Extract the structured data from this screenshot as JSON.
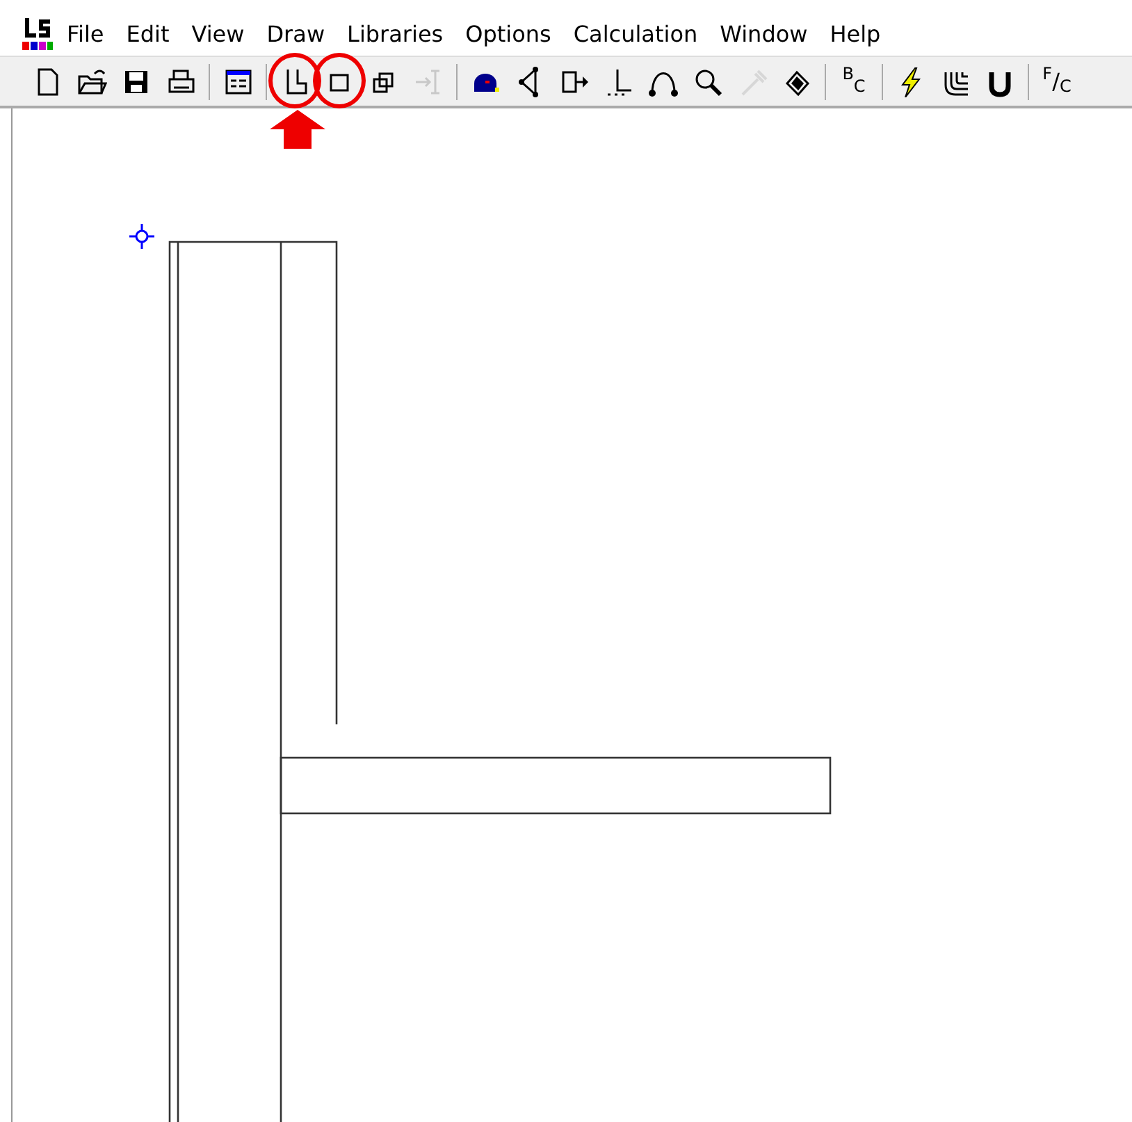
{
  "menu": [
    "File",
    "Edit",
    "View",
    "Draw",
    "Libraries",
    "Options",
    "Calculation",
    "Window",
    "Help"
  ],
  "toolbar": [
    {
      "kind": "icon",
      "disabled": false
    },
    {
      "kind": "icon",
      "disabled": false
    },
    {
      "kind": "icon",
      "disabled": false
    },
    {
      "kind": "icon",
      "disabled": false
    },
    {
      "kind": "separator"
    },
    {
      "kind": "icon",
      "disabled": false
    },
    {
      "kind": "separator"
    },
    {
      "kind": "icon",
      "disabled": false,
      "circled": true,
      "arrow_below": true
    },
    {
      "kind": "icon",
      "disabled": false,
      "circled": true,
      "arrow_below": false
    },
    {
      "kind": "icon",
      "disabled": false
    },
    {
      "kind": "icon",
      "disabled": true
    },
    {
      "kind": "separator"
    },
    {
      "kind": "icon",
      "disabled": false
    },
    {
      "kind": "icon",
      "disabled": false
    },
    {
      "kind": "icon",
      "disabled": false
    },
    {
      "kind": "icon",
      "disabled": false
    },
    {
      "kind": "icon",
      "disabled": false
    },
    {
      "kind": "icon",
      "disabled": false
    },
    {
      "kind": "icon",
      "disabled": true
    },
    {
      "kind": "icon",
      "disabled": false
    },
    {
      "kind": "separator"
    },
    {
      "kind": "text",
      "label": "$^{B}$$_{C}$"
    },
    {
      "kind": "separator"
    },
    {
      "kind": "icon",
      "disabled": false
    },
    {
      "kind": "icon",
      "disabled": false
    },
    {
      "kind": "icon",
      "disabled": false
    },
    {
      "kind": "separator"
    },
    {
      "kind": "text",
      "label": "$^{F}$/$_{C}$"
    }
  ]
}
